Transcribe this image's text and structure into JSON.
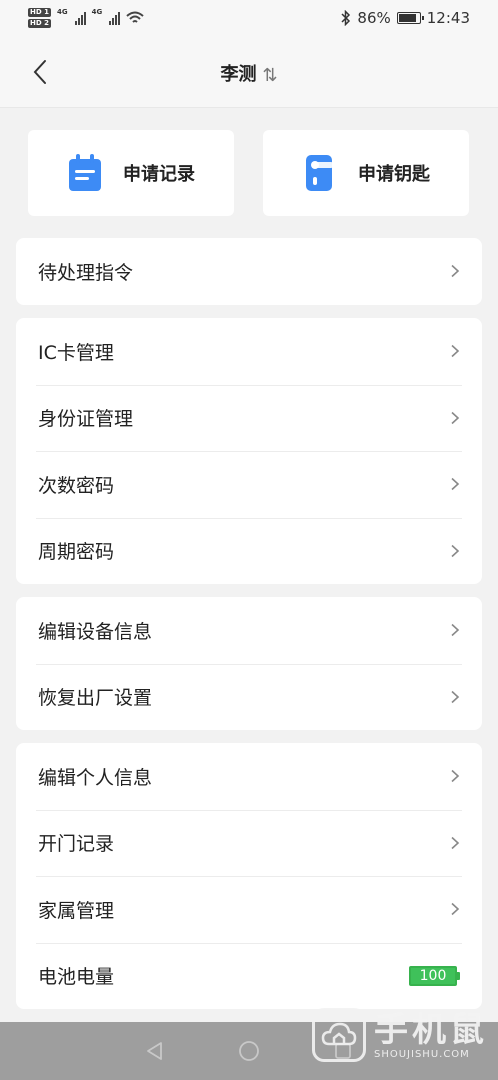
{
  "status_bar": {
    "hd1": "HD 1",
    "hd2": "HD 2",
    "net1": "4G",
    "net2": "4G",
    "battery_percent": "86%",
    "time": "12:43"
  },
  "header": {
    "title": "李测",
    "swap_glyph": "⇅"
  },
  "quick_actions": [
    {
      "label": "申请记录",
      "icon": "calendar-icon"
    },
    {
      "label": "申请钥匙",
      "icon": "door-key-icon"
    }
  ],
  "groups": [
    {
      "items": [
        {
          "label": "待处理指令"
        }
      ]
    },
    {
      "items": [
        {
          "label": "IC卡管理"
        },
        {
          "label": "身份证管理"
        },
        {
          "label": "次数密码"
        },
        {
          "label": "周期密码"
        }
      ]
    },
    {
      "items": [
        {
          "label": "编辑设备信息"
        },
        {
          "label": "恢复出厂设置"
        }
      ]
    },
    {
      "items": [
        {
          "label": "编辑个人信息"
        },
        {
          "label": "开门记录"
        },
        {
          "label": "家属管理"
        },
        {
          "label": "电池电量",
          "battery_level": "100"
        }
      ]
    }
  ],
  "watermark": {
    "cn": "手机鼠",
    "en": "SHOUJISHU.COM"
  },
  "colors": {
    "accent_blue": "#3d8bf5",
    "battery_green": "#3fc15a"
  }
}
